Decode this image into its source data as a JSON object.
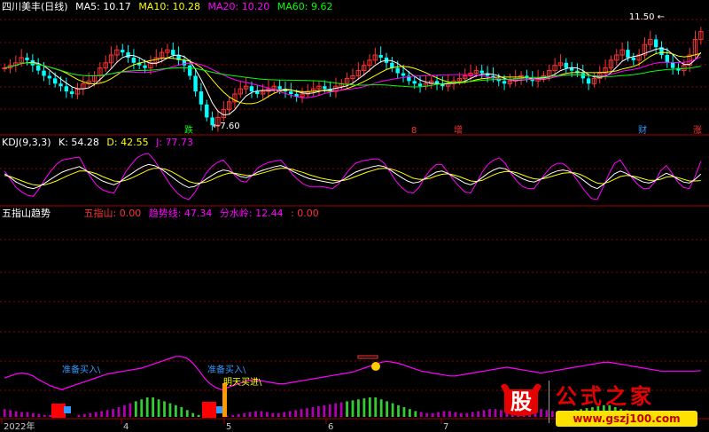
{
  "panel_main": {
    "title": "四川美丰(日线)",
    "ma": [
      {
        "label": "MA5: ",
        "value": "10.17",
        "color": "#ffffff"
      },
      {
        "label": "MA10: ",
        "value": "10.28",
        "color": "#ffff00"
      },
      {
        "label": "MA20: ",
        "value": "10.20",
        "color": "#ff00ff"
      },
      {
        "label": "MA60: ",
        "value": "9.62",
        "color": "#00ff00"
      }
    ],
    "high_label": "11.50",
    "low_label": "7.60",
    "markers": [
      {
        "text": "跌",
        "color": "#00ff00"
      },
      {
        "text": "8",
        "color": "#ff3030"
      },
      {
        "text": "增",
        "color": "#ff3030"
      },
      {
        "text": "财",
        "color": "#3399ff"
      },
      {
        "text": "涨",
        "color": "#ff3030"
      }
    ]
  },
  "panel_kdj": {
    "title": "KDJ(9,3,3)",
    "k_label": "K: ",
    "k": "54.28",
    "d_label": "D: ",
    "d": "42.55",
    "j_label": "J: ",
    "j": "77.73"
  },
  "panel_wzs": {
    "title": "五指山趋势",
    "wzs_label": "五指山: ",
    "wzs": "0.00",
    "trend_label": "趋势线: ",
    "trend": "47.34",
    "fsl_label": "分水岭: ",
    "fsl": "12.44",
    "extra": ": 0.00",
    "annotations": [
      "准备买入\\",
      "准备买入\\",
      "明天买进\\"
    ]
  },
  "x_axis": {
    "labels": [
      "2022年",
      "4",
      "5",
      "6",
      "7"
    ]
  },
  "watermark": {
    "logo_char": "股",
    "title": "公式之家",
    "url": "www.gszj100.com"
  },
  "colors": {
    "up": "#ff3333",
    "down": "#00ffff",
    "k": "#ffffff",
    "d": "#ffff00",
    "j": "#ff00ff",
    "grid": "#8b0000"
  },
  "chart_data": [
    {
      "type": "candlestick",
      "title": "四川美丰(日线)",
      "ylim": [
        7.4,
        11.9
      ],
      "summary": {
        "high": 11.5,
        "low": 7.6
      },
      "series": [
        {
          "name": "MA5",
          "last": 10.17
        },
        {
          "name": "MA10",
          "last": 10.28
        },
        {
          "name": "MA20",
          "last": 10.2
        },
        {
          "name": "MA60",
          "last": 9.62
        }
      ],
      "close": [
        9.9,
        10.0,
        10.1,
        10.3,
        10.2,
        10.0,
        9.8,
        9.6,
        9.5,
        9.3,
        9.2,
        9.0,
        8.9,
        9.1,
        9.3,
        9.4,
        9.6,
        9.9,
        10.1,
        10.4,
        10.6,
        10.5,
        10.3,
        10.1,
        10.0,
        9.9,
        10.1,
        10.3,
        10.5,
        10.6,
        10.4,
        10.2,
        10.0,
        9.6,
        9.0,
        8.5,
        8.0,
        7.7,
        8.0,
        8.3,
        8.6,
        8.9,
        9.1,
        9.2,
        9.0,
        8.9,
        9.0,
        9.1,
        9.2,
        9.1,
        9.0,
        8.9,
        8.8,
        8.9,
        9.0,
        9.1,
        9.2,
        9.1,
        9.0,
        9.2,
        9.3,
        9.5,
        9.6,
        9.8,
        10.0,
        10.2,
        10.4,
        10.3,
        10.1,
        9.9,
        9.7,
        9.6,
        9.4,
        9.3,
        9.2,
        9.3,
        9.4,
        9.3,
        9.2,
        9.3,
        9.4,
        9.5,
        9.6,
        9.7,
        9.8,
        9.7,
        9.6,
        9.5,
        9.4,
        9.3,
        9.4,
        9.5,
        9.6,
        9.5,
        9.4,
        9.5,
        9.6,
        9.8,
        10.0,
        10.1,
        9.9,
        9.8,
        9.7,
        9.5,
        9.3,
        9.5,
        9.7,
        9.9,
        10.2,
        10.4,
        10.6,
        10.3,
        10.2,
        10.4,
        10.8,
        11.0,
        10.7,
        10.4,
        10.1,
        9.9,
        9.8,
        10.0,
        10.4,
        11.0,
        11.3
      ]
    },
    {
      "type": "line",
      "title": "KDJ(9,3,3)",
      "ylim": [
        0,
        100
      ],
      "series": [
        {
          "name": "K",
          "last": 54.28
        },
        {
          "name": "D",
          "last": 42.55
        },
        {
          "name": "J",
          "last": 77.73
        }
      ],
      "K": [
        55,
        48,
        40,
        35,
        30,
        28,
        32,
        38,
        45,
        52,
        58,
        62,
        65,
        68,
        62,
        55,
        48,
        42,
        38,
        35,
        40,
        48,
        55,
        62,
        68,
        72,
        70,
        65,
        58,
        50,
        42,
        35,
        30,
        32,
        38,
        45,
        52,
        58,
        62,
        60,
        55,
        50,
        48,
        52,
        58,
        62,
        65,
        68,
        70,
        66,
        60,
        55,
        50,
        46,
        44,
        42,
        40,
        38,
        40,
        45,
        52,
        58,
        62,
        65,
        68,
        70,
        68,
        62,
        55,
        48,
        42,
        38,
        40,
        46,
        52,
        58,
        60,
        56,
        50,
        44,
        38,
        35,
        40,
        48,
        56,
        62,
        66,
        64,
        58,
        52,
        46,
        42,
        40,
        44,
        50,
        56,
        60,
        62,
        60,
        55,
        48,
        40,
        32,
        28,
        35,
        45,
        55,
        60,
        56,
        50,
        45,
        40,
        38,
        42,
        50,
        56,
        52,
        45,
        40,
        38,
        45,
        54.28
      ],
      "D": [
        52,
        50,
        46,
        42,
        38,
        35,
        34,
        35,
        38,
        42,
        47,
        52,
        56,
        60,
        60,
        58,
        55,
        50,
        46,
        42,
        41,
        43,
        47,
        52,
        57,
        62,
        65,
        65,
        63,
        59,
        53,
        47,
        41,
        38,
        38,
        40,
        44,
        49,
        53,
        56,
        56,
        54,
        52,
        52,
        54,
        57,
        60,
        63,
        65,
        65,
        63,
        60,
        57,
        53,
        50,
        47,
        45,
        43,
        42,
        43,
        46,
        50,
        54,
        58,
        61,
        64,
        65,
        64,
        61,
        57,
        52,
        47,
        45,
        45,
        47,
        51,
        54,
        55,
        53,
        50,
        46,
        42,
        41,
        43,
        48,
        53,
        57,
        59,
        59,
        57,
        53,
        49,
        46,
        45,
        47,
        50,
        53,
        56,
        57,
        57,
        54,
        49,
        43,
        38,
        37,
        40,
        45,
        50,
        52,
        51,
        49,
        46,
        43,
        43,
        45,
        49,
        50,
        48,
        45,
        42,
        42,
        42.55
      ],
      "J": [
        60,
        45,
        30,
        22,
        16,
        14,
        28,
        45,
        60,
        72,
        80,
        82,
        84,
        85,
        66,
        48,
        34,
        26,
        22,
        20,
        38,
        58,
        72,
        84,
        90,
        92,
        80,
        64,
        48,
        32,
        20,
        12,
        8,
        20,
        38,
        56,
        68,
        76,
        80,
        68,
        52,
        42,
        40,
        52,
        66,
        72,
        76,
        78,
        80,
        68,
        54,
        44,
        36,
        32,
        32,
        32,
        30,
        28,
        36,
        50,
        64,
        74,
        78,
        80,
        82,
        82,
        74,
        58,
        42,
        30,
        22,
        20,
        30,
        48,
        62,
        72,
        72,
        58,
        44,
        32,
        22,
        20,
        38,
        58,
        72,
        80,
        84,
        74,
        56,
        42,
        32,
        28,
        28,
        42,
        56,
        68,
        74,
        74,
        66,
        51,
        36,
        22,
        10,
        8,
        30,
        54,
        74,
        80,
        64,
        48,
        36,
        28,
        28,
        40,
        60,
        70,
        56,
        40,
        30,
        28,
        50,
        77.73
      ]
    },
    {
      "type": "bar",
      "title": "五指山趋势",
      "ylim": [
        0,
        100
      ],
      "series": [
        {
          "name": "五指山",
          "last": 0.0
        },
        {
          "name": "趋势线",
          "last": 47.34
        },
        {
          "name": "分水岭",
          "last": 12.44
        }
      ],
      "trend": [
        40,
        42,
        44,
        45,
        44,
        42,
        38,
        35,
        32,
        30,
        28,
        30,
        32,
        34,
        36,
        38,
        40,
        42,
        44,
        45,
        46,
        47,
        48,
        49,
        50,
        52,
        54,
        56,
        58,
        60,
        62,
        62,
        60,
        55,
        48,
        40,
        34,
        30,
        28,
        30,
        32,
        34,
        36,
        38,
        38,
        37,
        36,
        35,
        34,
        34,
        35,
        36,
        37,
        38,
        39,
        40,
        41,
        42,
        43,
        44,
        45,
        46,
        48,
        50,
        52,
        54,
        56,
        57,
        56,
        55,
        53,
        51,
        49,
        47,
        46,
        45,
        44,
        43,
        42,
        42,
        43,
        44,
        45,
        46,
        47,
        48,
        49,
        50,
        51,
        50,
        49,
        48,
        47,
        46,
        45,
        46,
        47,
        48,
        49,
        50,
        51,
        52,
        53,
        54,
        55,
        56,
        56,
        55,
        54,
        53,
        52,
        51,
        50,
        49,
        48,
        47,
        47,
        47,
        47,
        47,
        47,
        47,
        47.34
      ],
      "bars": [
        8,
        7,
        6,
        5,
        5,
        4,
        3,
        2,
        2,
        1,
        1,
        0,
        0,
        2,
        3,
        4,
        5,
        6,
        7,
        8,
        10,
        12,
        14,
        16,
        18,
        20,
        20,
        18,
        16,
        14,
        12,
        10,
        7,
        4,
        2,
        1,
        0,
        0,
        0,
        1,
        2,
        3,
        4,
        5,
        6,
        6,
        5,
        4,
        4,
        5,
        6,
        7,
        8,
        9,
        10,
        11,
        12,
        13,
        14,
        15,
        16,
        17,
        18,
        19,
        20,
        20,
        18,
        16,
        14,
        12,
        10,
        8,
        6,
        5,
        4,
        4,
        5,
        6,
        6,
        5,
        4,
        4,
        5,
        6,
        7,
        8,
        8,
        7,
        6,
        5,
        5,
        6,
        7,
        8,
        8,
        7,
        6,
        5,
        5,
        6,
        7,
        8,
        9,
        10,
        11,
        12,
        12,
        10,
        8,
        7,
        6,
        5,
        4,
        3,
        2,
        2,
        1,
        1,
        1,
        1,
        2,
        2
      ]
    }
  ]
}
